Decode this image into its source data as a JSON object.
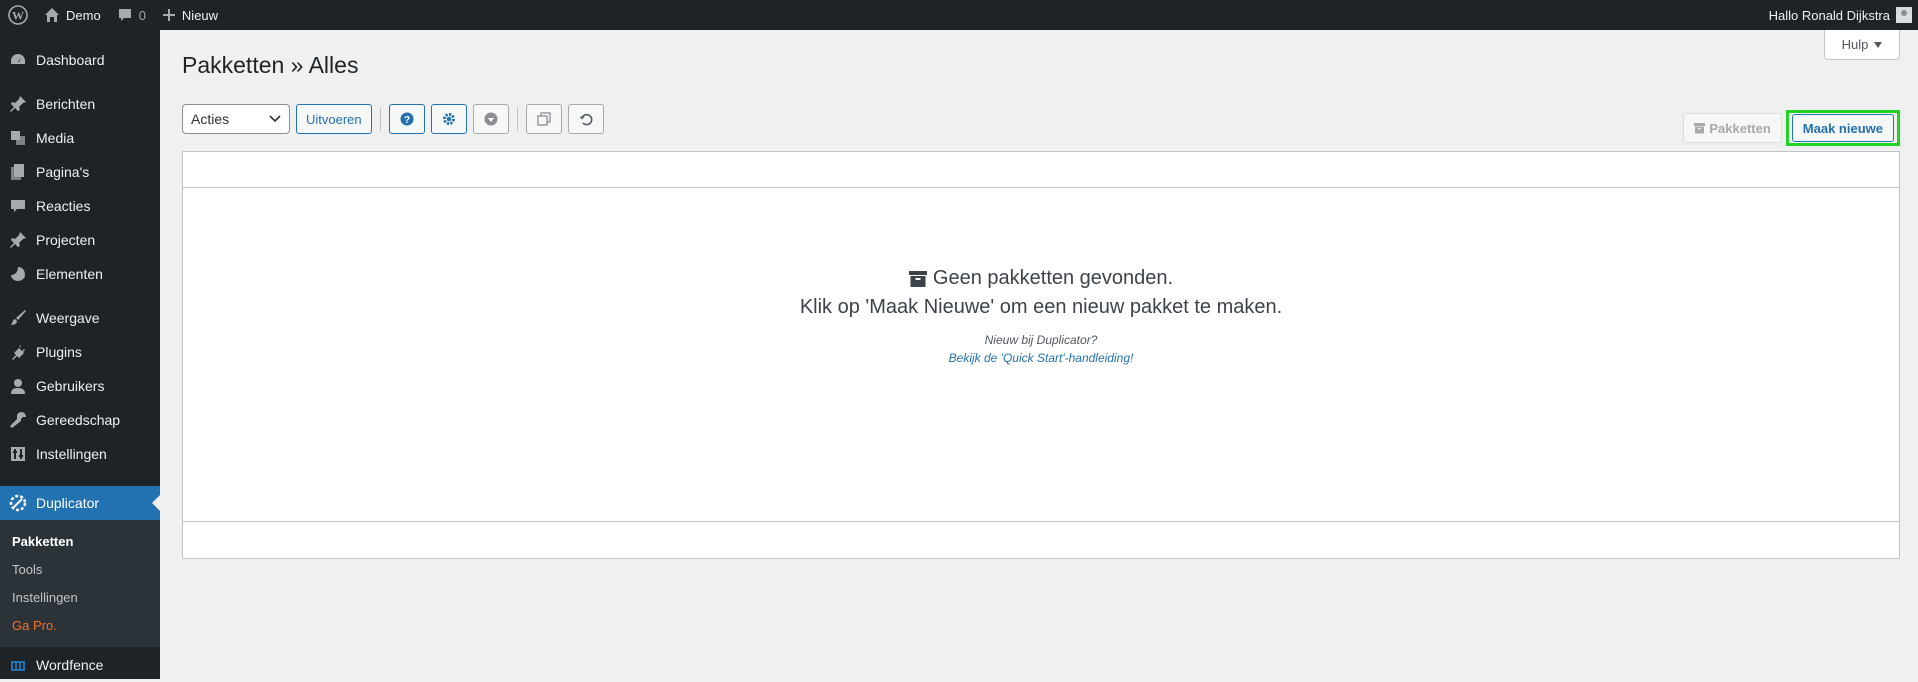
{
  "adminbar": {
    "site_name": "Demo",
    "comments_count": "0",
    "new_label": "Nieuw",
    "greeting": "Hallo Ronald Dijkstra"
  },
  "sidebar": {
    "items": [
      {
        "label": "Dashboard",
        "icon": "dashboard-icon"
      },
      {
        "label": "Berichten",
        "icon": "pin-icon"
      },
      {
        "label": "Media",
        "icon": "media-icon"
      },
      {
        "label": "Pagina's",
        "icon": "pages-icon"
      },
      {
        "label": "Reacties",
        "icon": "comment-icon"
      },
      {
        "label": "Projecten",
        "icon": "pin-icon"
      },
      {
        "label": "Elementen",
        "icon": "elements-icon"
      },
      {
        "label": "Weergave",
        "icon": "brush-icon"
      },
      {
        "label": "Plugins",
        "icon": "plugin-icon"
      },
      {
        "label": "Gebruikers",
        "icon": "user-icon"
      },
      {
        "label": "Gereedschap",
        "icon": "wrench-icon"
      },
      {
        "label": "Instellingen",
        "icon": "settings-icon"
      },
      {
        "label": "Duplicator",
        "icon": "duplicator-icon"
      },
      {
        "label": "Wordfence",
        "icon": "wordfence-icon"
      }
    ],
    "submenu": {
      "packages": "Pakketten",
      "tools": "Tools",
      "settings": "Instellingen",
      "pro": "Ga Pro."
    }
  },
  "main": {
    "help_label": "Hulp",
    "title": "Pakketten » Alles",
    "actions_select": "Acties",
    "apply_button": "Uitvoeren",
    "packages_tab": "Pakketten",
    "create_new_button": "Maak nieuwe",
    "empty": {
      "line1": "Geen pakketten gevonden.",
      "line2": "Klik op 'Maak Nieuwe' om een nieuw pakket te maken.",
      "hint": "Nieuw bij Duplicator?",
      "link": "Bekijk de 'Quick Start'-handleiding!"
    }
  },
  "colors": {
    "adminbar_bg": "#1d2327",
    "accent": "#2271b1",
    "highlight": "#22d422",
    "pro": "#f56e28"
  }
}
